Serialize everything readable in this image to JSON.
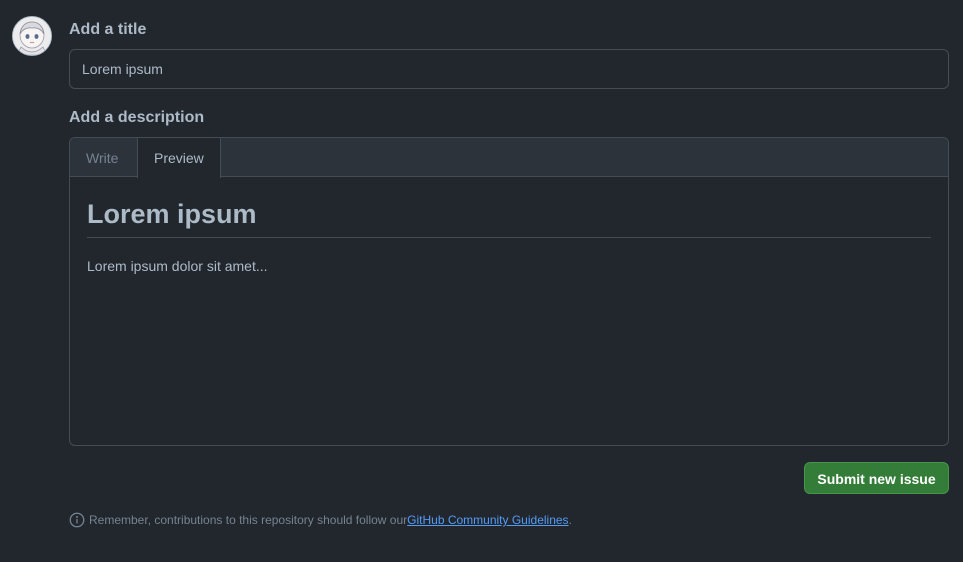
{
  "avatar": {
    "icon": "user-avatar"
  },
  "title_section": {
    "label": "Add a title",
    "input_value": "Lorem ipsum"
  },
  "description_section": {
    "label": "Add a description",
    "tabs": [
      {
        "label": "Write",
        "active": false
      },
      {
        "label": "Preview",
        "active": true
      }
    ],
    "preview": {
      "heading": "Lorem ipsum",
      "body": "Lorem ipsum dolor sit amet..."
    }
  },
  "actions": {
    "submit_label": "Submit new issue"
  },
  "footnote": {
    "icon": "info-icon",
    "text_before": "Remember, contributions to this repository should follow our ",
    "link_text": "GitHub Community Guidelines",
    "text_after": "."
  },
  "colors": {
    "background": "#22272e",
    "border": "#444c56",
    "text": "#adbac7",
    "muted": "#768390",
    "link": "#539bf5",
    "submit": "#347d39"
  }
}
